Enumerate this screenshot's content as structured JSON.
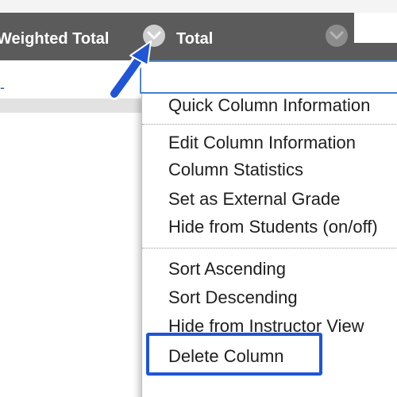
{
  "header": {
    "columns": [
      {
        "title": "Weighted Total"
      },
      {
        "title": "Total"
      }
    ]
  },
  "row": {
    "cell_value": "-"
  },
  "menu": {
    "items": [
      {
        "label": "Quick Column Information"
      },
      {
        "label": "Edit Column Information"
      },
      {
        "label": "Column Statistics"
      },
      {
        "label": "Set as External Grade"
      },
      {
        "label": "Hide from Students (on/off)"
      },
      {
        "label": "Sort Ascending"
      },
      {
        "label": "Sort Descending"
      },
      {
        "label": "Hide from Instructor View"
      },
      {
        "label": "Delete Column"
      }
    ],
    "highlighted_item": "Delete Column"
  },
  "colors": {
    "header_background": "#5b5b5b",
    "header_text": "#ffffff",
    "highlight_border": "#1f55d6",
    "arrow": "#1f55d6",
    "active_cell_border": "#4a86d9"
  },
  "icons": {
    "column_menu_button": "chevron-down-icon",
    "pointer": "arrow-icon"
  }
}
